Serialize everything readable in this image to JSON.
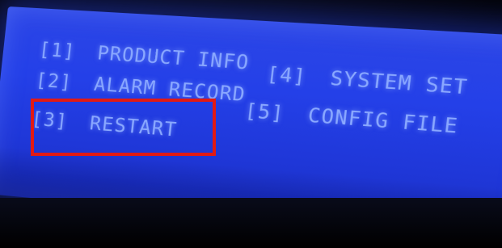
{
  "lcd": {
    "background_color": "#2440e8",
    "text_color": "#8aa8ff",
    "menu": [
      {
        "key": "[1]",
        "label": "PRODUCT INFO"
      },
      {
        "key": "[2]",
        "label": "ALARM RECORD"
      },
      {
        "key": "[3]",
        "label": "RESTART"
      },
      {
        "key": "[4]",
        "label": "SYSTEM SET"
      },
      {
        "key": "[5]",
        "label": "CONFIG FILE"
      }
    ]
  },
  "highlight": {
    "color": "#e21a14",
    "target": "menu-item-restart"
  }
}
